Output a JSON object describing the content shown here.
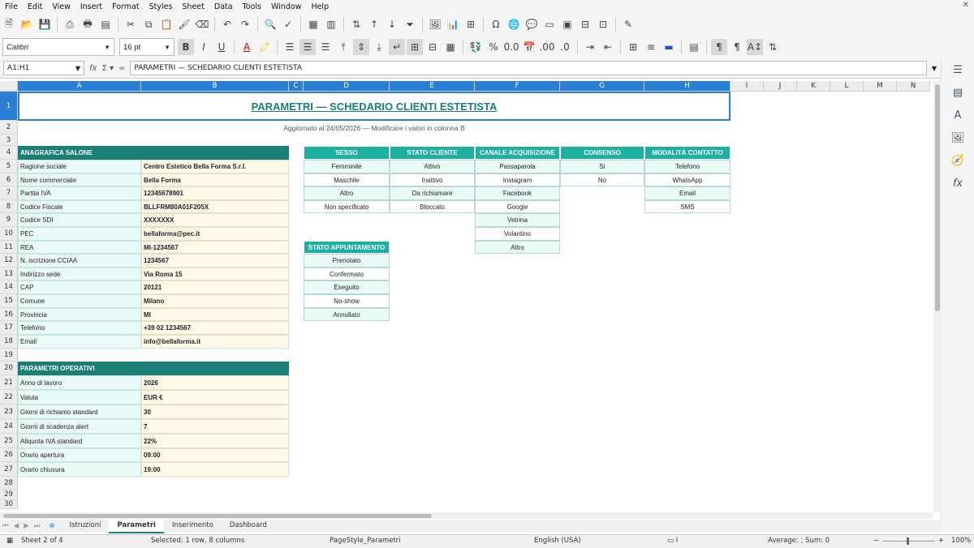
{
  "menu": [
    "File",
    "Edit",
    "View",
    "Insert",
    "Format",
    "Styles",
    "Sheet",
    "Data",
    "Tools",
    "Window",
    "Help"
  ],
  "font": {
    "name": "Calibri",
    "size": "16 pt"
  },
  "formula": {
    "namebox": "A1:H1",
    "content": "PARAMETRI — SCHEDARIO CLIENTI ESTETISTA"
  },
  "columns": [
    "A",
    "B",
    "C",
    "D",
    "E",
    "F",
    "G",
    "H",
    "I",
    "J",
    "K",
    "L",
    "M",
    "N"
  ],
  "rows": [
    "1",
    "2",
    "3",
    "4",
    "5",
    "6",
    "7",
    "8",
    "9",
    "10",
    "11",
    "12",
    "13",
    "14",
    "15",
    "16",
    "17",
    "18",
    "19",
    "20",
    "21",
    "22",
    "23",
    "24",
    "25",
    "26",
    "27",
    "28",
    "29",
    "30"
  ],
  "title": "PARAMETRI — SCHEDARIO CLIENTI ESTETISTA",
  "subtitle": "Aggiornato al 24/05/2026 — Modificare i valori in colonna B",
  "anagrafica": {
    "header": "ANAGRAFICA SALONE",
    "rows": [
      {
        "label": "Ragione sociale",
        "value": "Centro Estetico Bella Forma S.r.l."
      },
      {
        "label": "Nome commerciale",
        "value": "Bella Forma"
      },
      {
        "label": "Partita IVA",
        "value": "12345678901"
      },
      {
        "label": "Codice Fiscale",
        "value": "BLLFRM80A01F205X"
      },
      {
        "label": "Codice SDI",
        "value": "XXXXXXX"
      },
      {
        "label": "PEC",
        "value": "bellaforma@pec.it"
      },
      {
        "label": "REA",
        "value": "MI-1234567"
      },
      {
        "label": "N. iscrizione CCIAA",
        "value": "1234567"
      },
      {
        "label": "Indirizzo sede",
        "value": "Via Roma 15"
      },
      {
        "label": "CAP",
        "value": "20121"
      },
      {
        "label": "Comune",
        "value": "Milano"
      },
      {
        "label": "Provincia",
        "value": "MI"
      },
      {
        "label": "Telefono",
        "value": "+39 02 1234567"
      },
      {
        "label": "Email",
        "value": "info@bellaforma.it"
      }
    ]
  },
  "operativi": {
    "header": "PARAMETRI OPERATIVI",
    "rows": [
      {
        "label": "Anno di lavoro",
        "value": "2026"
      },
      {
        "label": "Valuta",
        "value": "EUR €"
      },
      {
        "label": "Giorni di richiamo standard",
        "value": "30"
      },
      {
        "label": "Giorni di scadenza alert",
        "value": "7"
      },
      {
        "label": "Aliquota IVA standard",
        "value": "22%"
      },
      {
        "label": "Orario apertura",
        "value": "09:00"
      },
      {
        "label": "Orario chiusura",
        "value": "19:00"
      }
    ]
  },
  "lists": [
    {
      "header": "SESSO",
      "items": [
        "Femminile",
        "Maschile",
        "Altro",
        "Non specificato"
      ]
    },
    {
      "header": "STATO CLIENTE",
      "items": [
        "Attivo",
        "Inattivo",
        "Da richiamare",
        "Bloccato"
      ]
    },
    {
      "header": "CANALE ACQUISIZIONE",
      "items": [
        "Passaparola",
        "Instagram",
        "Facebook",
        "Google",
        "Vetrina",
        "Volantino",
        "Altro"
      ]
    },
    {
      "header": "CONSENSO",
      "items": [
        "Sì",
        "No"
      ]
    },
    {
      "header": "MODALITÀ CONTATTO",
      "items": [
        "Telefono",
        "WhatsApp",
        "Email",
        "SMS"
      ]
    }
  ],
  "appuntamento": {
    "header": "STATO APPUNTAMENTO",
    "items": [
      "Prenotato",
      "Confermato",
      "Eseguito",
      "No-show",
      "Annullato"
    ]
  },
  "tabs": [
    "Istruzioni",
    "Parametri",
    "Inserimento",
    "Dashboard"
  ],
  "active_tab": "Parametri",
  "status": {
    "sheet": "Sheet 2 of 4",
    "selection": "Selected: 1 row, 8 columns",
    "pagestyle": "PageStyle_Parametri",
    "language": "English (USA)",
    "sum": "Average: ; Sum: 0",
    "zoom": "100%"
  },
  "colors": {
    "teal_dark": "#1a7f74",
    "teal_light": "#1cb0a0",
    "label_bg": "#eafaf7",
    "value_bg": "#fdf9e8",
    "select": "#2a7fd4"
  }
}
